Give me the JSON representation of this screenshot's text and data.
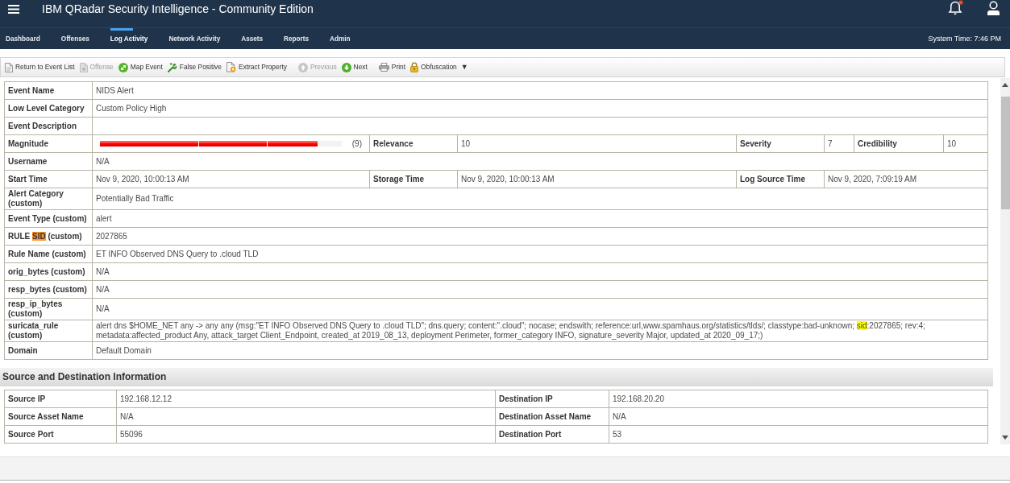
{
  "header": {
    "title": "IBM QRadar Security Intelligence - Community Edition",
    "alerts_unread": true
  },
  "nav": {
    "tabs": [
      {
        "label": "Dashboard",
        "selected": false
      },
      {
        "label": "Offenses",
        "selected": false
      },
      {
        "label": "Log Activity",
        "selected": true
      },
      {
        "label": "Network Activity",
        "selected": false
      },
      {
        "label": "Assets",
        "selected": false
      },
      {
        "label": "Reports",
        "selected": false
      },
      {
        "label": "Admin",
        "selected": false
      }
    ],
    "system_time": "System Time: 7:46 PM"
  },
  "toolbar": {
    "groups": [
      {
        "items": [
          {
            "label": "Return to Event List",
            "disabled": false
          },
          {
            "label": "Offense",
            "disabled": true
          },
          {
            "label": "Map Event",
            "disabled": false
          },
          {
            "label": "False Positive",
            "disabled": false
          },
          {
            "label": "Extract Property",
            "disabled": false
          }
        ]
      },
      {
        "items": [
          {
            "label": "Previous",
            "disabled": true
          },
          {
            "label": "Next",
            "disabled": false
          }
        ]
      },
      {
        "items": [
          {
            "label": "Print",
            "disabled": false
          },
          {
            "label": "Obfuscation",
            "disabled": false,
            "caret": "▼"
          }
        ]
      }
    ]
  },
  "event_details": {
    "rows": [
      {
        "fields": [
          {
            "kind": "text",
            "label": "Event Name",
            "value": "NIDS Alert"
          }
        ]
      },
      {
        "fields": [
          {
            "kind": "text",
            "label": "Low Level Category",
            "value": "Custom Policy High"
          }
        ]
      },
      {
        "fields": [
          {
            "kind": "text",
            "label": "Event Description"
          }
        ]
      },
      {
        "fields": [
          {
            "kind": "meter",
            "label": "Magnitude",
            "level": 0.9,
            "reading": "(9)"
          },
          {
            "kind": "text",
            "label": "Relevance",
            "value": "10"
          },
          {
            "kind": "text",
            "label": "Severity",
            "value": "7"
          },
          {
            "kind": "text",
            "label": "Credibility",
            "value": "10"
          }
        ]
      },
      {
        "fields": [
          {
            "kind": "text",
            "label": "Username",
            "value": "N/A"
          }
        ]
      },
      {
        "fields": [
          {
            "kind": "text",
            "label": "Start Time",
            "value": "Nov 9, 2020, 10:00:13 AM"
          },
          {
            "kind": "text",
            "label": "Storage Time",
            "value": "Nov 9, 2020, 10:00:13 AM"
          },
          {
            "kind": "text",
            "label": "Log Source Time",
            "value": "Nov 9, 2020, 7:09:19 AM"
          }
        ]
      },
      {
        "fields": [
          {
            "kind": "text",
            "label": "Alert Category (custom)",
            "value": "Potentially Bad Traffic"
          }
        ]
      },
      {
        "fields": [
          {
            "kind": "text",
            "label": "Event Type (custom)",
            "value": "alert"
          }
        ]
      },
      {
        "fields": [
          {
            "kind": "text",
            "label_parts": [
              {
                "text": "RULE "
              },
              {
                "text": "SID",
                "color": "#ff9632"
              },
              {
                "text": " (custom)"
              }
            ],
            "value": "2027865"
          }
        ]
      },
      {
        "fields": [
          {
            "kind": "text",
            "label": "Rule Name (custom)",
            "value": "ET INFO Observed DNS Query to .cloud TLD"
          }
        ]
      },
      {
        "fields": [
          {
            "kind": "text",
            "label": "orig_bytes (custom)",
            "value": "N/A"
          }
        ]
      },
      {
        "fields": [
          {
            "kind": "text",
            "label": "resp_bytes (custom)",
            "value": "N/A"
          }
        ]
      },
      {
        "fields": [
          {
            "kind": "text",
            "label": "resp_ip_bytes (custom)",
            "value": "N/A"
          }
        ]
      },
      {
        "fields": [
          {
            "kind": "text",
            "label": "suricata_rule (custom)",
            "value_parts": [
              {
                "text": "alert dns $HOME_NET any -> any any (msg:\"ET INFO Observed DNS Query to .cloud TLD\"; dns.query; content:\".cloud\"; nocase; endswith; reference:url,www.spamhaus.org/statistics/tlds/; classtype:bad-unknown; "
              },
              {
                "text": "sid",
                "color": "#ffff00"
              },
              {
                "text": ":2027865; rev:4; metadata:affected_product Any, attack_target Client_Endpoint, created_at 2019_08_13, deployment Perimeter, former_category INFO, signature_severity Major, updated_at 2020_09_17;)"
              }
            ]
          }
        ]
      },
      {
        "fields": [
          {
            "kind": "text",
            "label": "Domain",
            "value": "Default Domain"
          }
        ]
      }
    ]
  },
  "source_destination": {
    "title": "Source and Destination Information",
    "rows": [
      {
        "fields": [
          {
            "label": "Source IP",
            "value": "192.168.12.12"
          },
          {
            "label": "Destination IP",
            "value": "192.168.20.20"
          }
        ]
      },
      {
        "fields": [
          {
            "label": "Source Asset Name",
            "value": "N/A"
          },
          {
            "label": "Destination Asset Name",
            "value": "N/A"
          }
        ]
      },
      {
        "fields": [
          {
            "label": "Source Port",
            "value": "55096"
          },
          {
            "label": "Destination Port",
            "value": "53"
          }
        ]
      }
    ]
  }
}
